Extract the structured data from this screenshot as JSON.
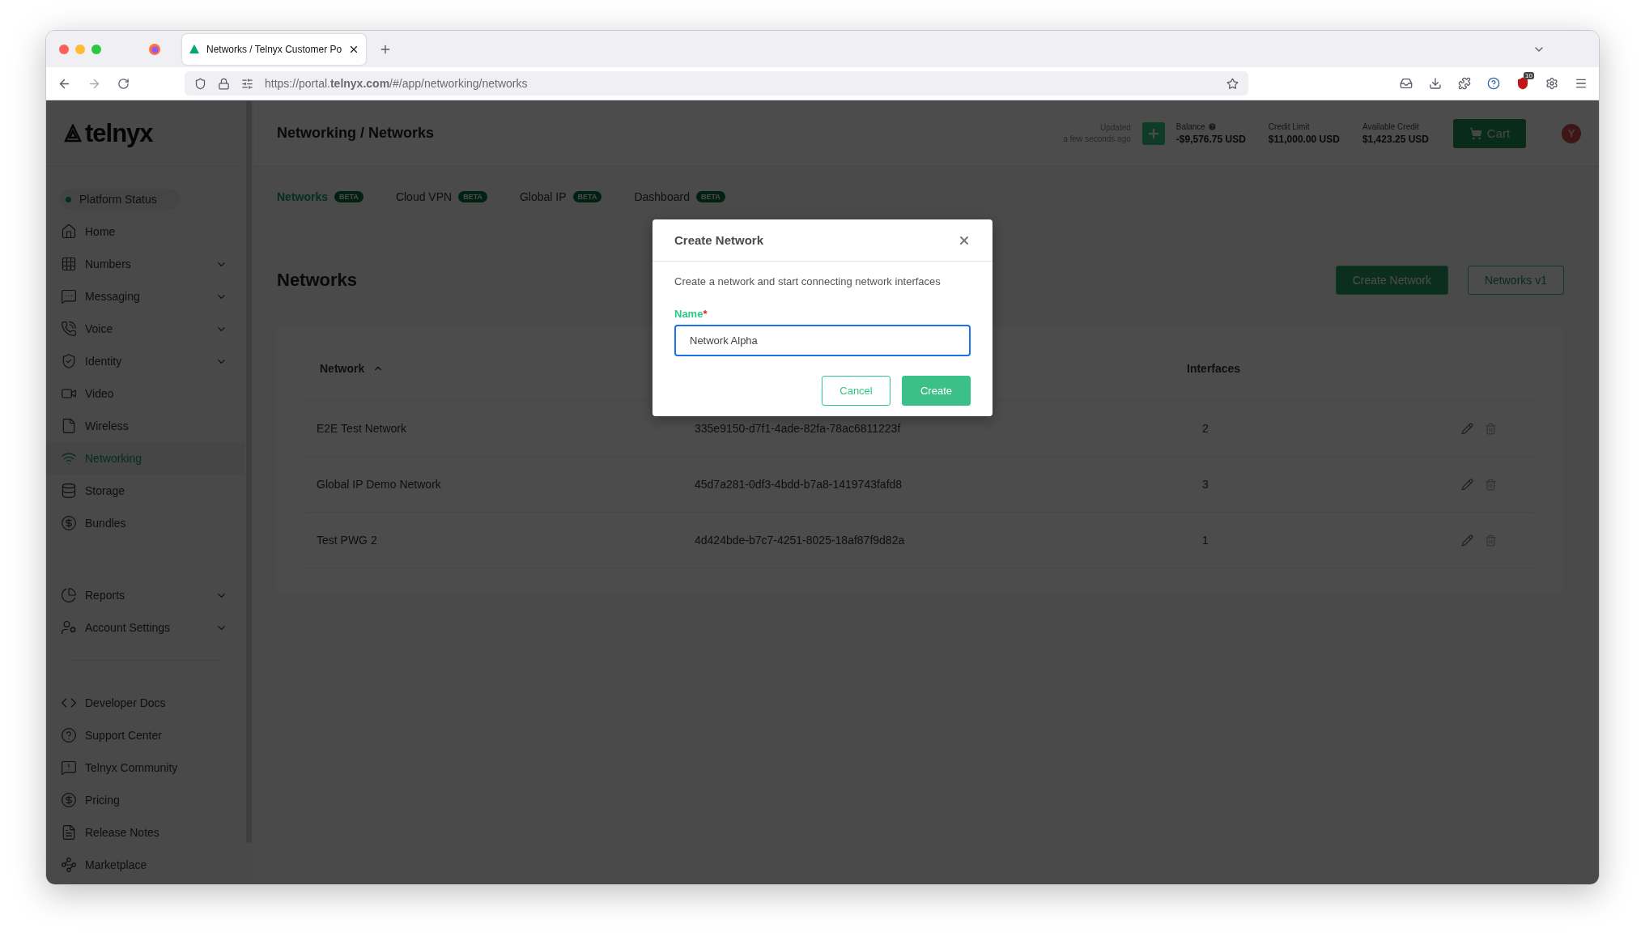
{
  "browser": {
    "tab": {
      "title": "Networks / Telnyx Customer Po"
    },
    "url": "https://portal.**telnyx.com**/#/app/networking/networks",
    "extension_badge": "10"
  },
  "sidebar": {
    "logo": "telnyx",
    "status": {
      "label": "Platform Status"
    },
    "items": [
      {
        "label": "Home",
        "has_submenu": false,
        "selected": false
      },
      {
        "label": "Numbers",
        "has_submenu": true,
        "selected": false
      },
      {
        "label": "Messaging",
        "has_submenu": true,
        "selected": false
      },
      {
        "label": "Voice",
        "has_submenu": true,
        "selected": false
      },
      {
        "label": "Identity",
        "has_submenu": true,
        "selected": false
      },
      {
        "label": "Video",
        "has_submenu": false,
        "selected": false
      },
      {
        "label": "Wireless",
        "has_submenu": false,
        "selected": false
      },
      {
        "label": "Networking",
        "has_submenu": false,
        "selected": true
      },
      {
        "label": "Storage",
        "has_submenu": false,
        "selected": false
      },
      {
        "label": "Bundles",
        "has_submenu": false,
        "selected": false
      }
    ],
    "secondary_items": [
      {
        "label": "Reports",
        "has_submenu": true,
        "selected": false
      },
      {
        "label": "Account Settings",
        "has_submenu": true,
        "selected": false
      }
    ],
    "links": [
      {
        "label": "Developer Docs"
      },
      {
        "label": "Support Center"
      },
      {
        "label": "Telnyx Community"
      },
      {
        "label": "Pricing"
      },
      {
        "label": "Release Notes"
      },
      {
        "label": "Marketplace"
      }
    ]
  },
  "header": {
    "breadcrumb": "Networking / Networks",
    "updated": {
      "label": "Updated",
      "time": "a few seconds ago"
    },
    "figures": [
      {
        "label": "Balance",
        "value": "-$9,576.75 USD",
        "has_help": true
      },
      {
        "label": "Credit Limit",
        "value": "$11,000.00 USD",
        "has_help": false
      },
      {
        "label": "Available Credit",
        "value": "$1,423.25 USD",
        "has_help": false
      }
    ],
    "cart_button": "Cart",
    "avatar": "Y"
  },
  "tabs": [
    {
      "label": "Networks",
      "badge": "BETA",
      "selected": true
    },
    {
      "label": "Cloud VPN",
      "badge": "BETA",
      "selected": false
    },
    {
      "label": "Global IP",
      "badge": "BETA",
      "selected": false
    },
    {
      "label": "Dashboard",
      "badge": "BETA",
      "selected": false
    }
  ],
  "page": {
    "heading": "Networks",
    "buttons": [
      {
        "label": "Create Network",
        "kind": "primary"
      },
      {
        "label": "Networks v1",
        "kind": "outline"
      }
    ]
  },
  "table": {
    "columns": [
      {
        "label": "Network",
        "sorted": true
      },
      {
        "label": "Interfaces",
        "sorted": false
      }
    ],
    "rows": [
      {
        "network": "E2E Test Network",
        "id": "335e9150-d7f1-4ade-82fa-78ac6811223f",
        "interfaces": "2"
      },
      {
        "network": "Global IP Demo Network",
        "id": "45d7a281-0df3-4bdd-b7a8-1419743fafd8",
        "interfaces": "3"
      },
      {
        "network": "Test PWG 2",
        "id": "4d424bde-b7c7-4251-8025-18af87f9d82a",
        "interfaces": "1"
      }
    ]
  },
  "modal": {
    "title": "Create Network",
    "description": "Create a network and start connecting network interfaces",
    "field": {
      "label": "Name",
      "required_mark": "*",
      "value": "Network Alpha",
      "focused": true
    },
    "buttons": [
      {
        "label": "Cancel",
        "kind": "outline"
      },
      {
        "label": "Create",
        "kind": "primary"
      }
    ]
  }
}
